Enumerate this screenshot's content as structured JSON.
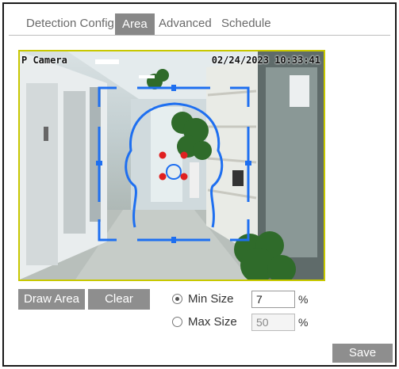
{
  "tabs": [
    {
      "label": "Detection Config",
      "active": false
    },
    {
      "label": "Area",
      "active": true
    },
    {
      "label": "Advanced",
      "active": false
    },
    {
      "label": "Schedule",
      "active": false
    }
  ],
  "video": {
    "camera_name": "P Camera",
    "timestamp": "02/24/2023 10:33:41",
    "border_color": "#c8c800",
    "overlay_color": "#1e6ff0",
    "marker_color": "#e02020"
  },
  "controls": {
    "draw_area_label": "Draw Area",
    "clear_label": "Clear",
    "min_size_label": "Min Size",
    "min_size_value": "7",
    "min_size_selected": true,
    "max_size_label": "Max Size",
    "max_size_value": "50",
    "max_size_selected": false,
    "unit": "%",
    "save_label": "Save"
  }
}
